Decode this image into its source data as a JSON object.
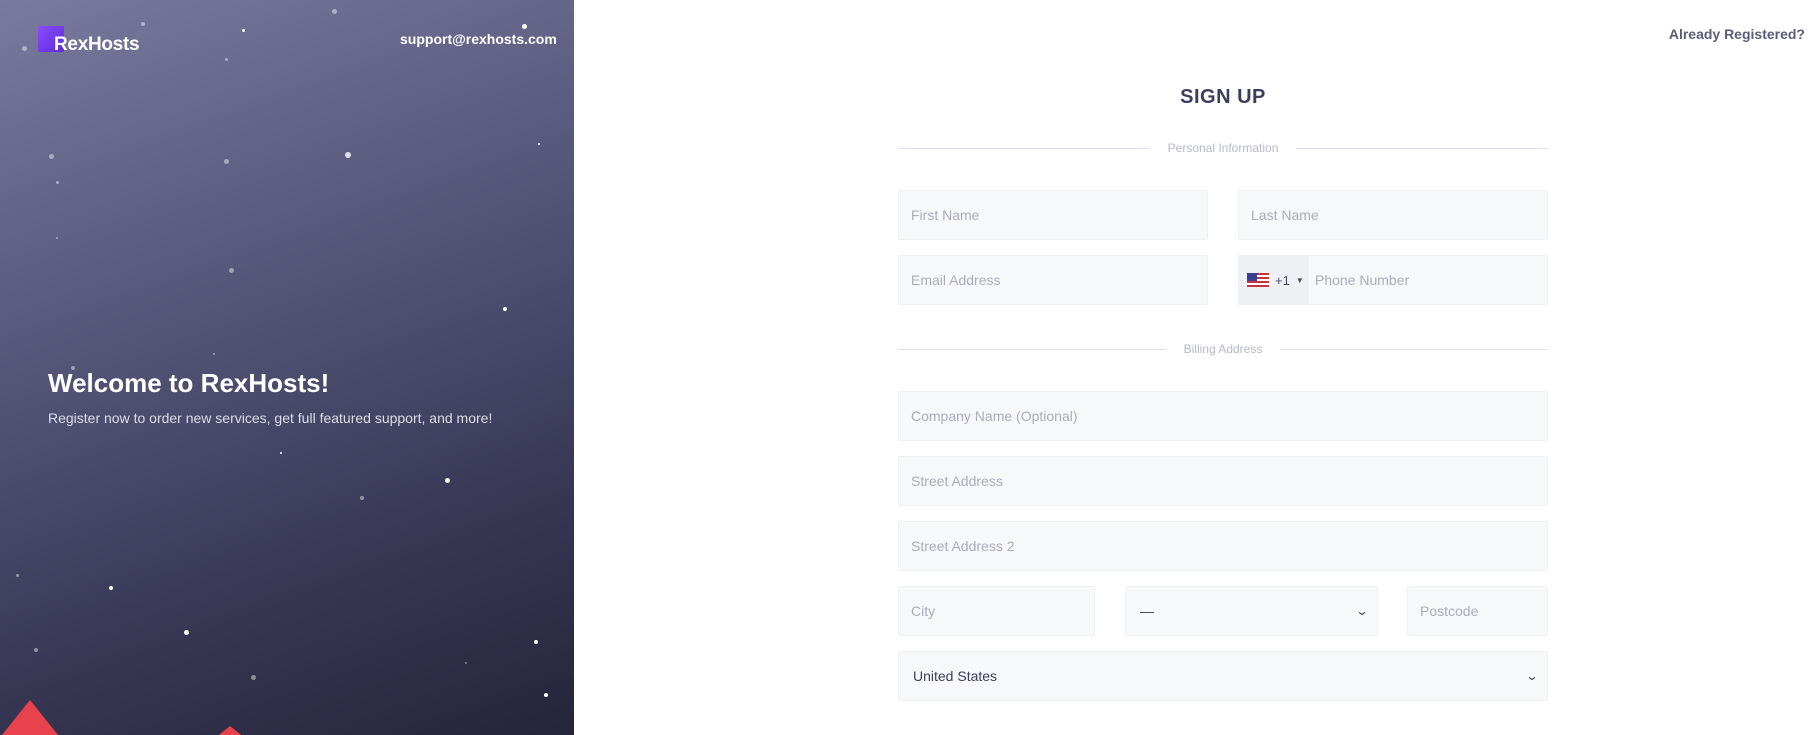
{
  "brand": {
    "name": "RexHosts",
    "logo_icon": "rexhosts-logo-icon"
  },
  "header": {
    "support_email": "support@rexhosts.com",
    "already_registered": "Already Registered?"
  },
  "hero": {
    "title": "Welcome to RexHosts!",
    "subtitle": "Register now to order new services, get full featured support, and more!"
  },
  "form": {
    "title": "SIGN UP",
    "personal_section": "Personal Information",
    "billing_section": "Billing Address",
    "first_name_placeholder": "First Name",
    "last_name_placeholder": "Last Name",
    "email_placeholder": "Email Address",
    "phone_country_code": "+1",
    "phone_placeholder": "Phone Number",
    "company_placeholder": "Company Name (Optional)",
    "street_placeholder": "Street Address",
    "street2_placeholder": "Street Address 2",
    "city_placeholder": "City",
    "state_value": "—",
    "postcode_placeholder": "Postcode",
    "country_value": "United States"
  },
  "colors": {
    "accent": "#8a4dff",
    "hero_dark": "#24243a",
    "field_bg": "#f7f8fa",
    "title": "#3b3f5c",
    "mountain": "#e8424d"
  }
}
